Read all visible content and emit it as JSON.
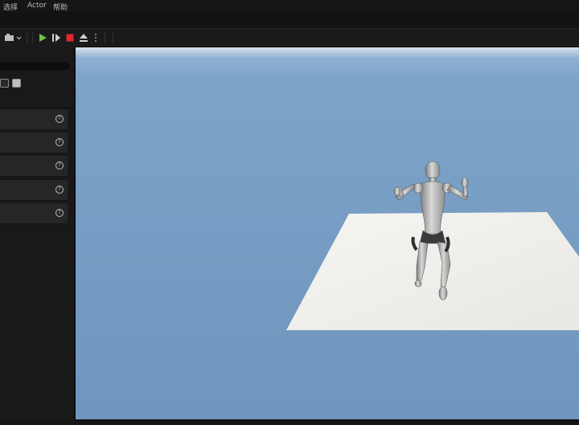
{
  "menubar": {
    "items": [
      {
        "label": "选择"
      },
      {
        "label": "Actor"
      },
      {
        "label": "帮助"
      }
    ]
  },
  "toolbar": {
    "icons": {
      "mode": "camera-icon",
      "play": "play-icon",
      "advance": "play-advance-icon",
      "stop": "stop-icon",
      "eject": "eject-icon",
      "more": "more-icon"
    },
    "colors": {
      "play": "#6cc34a",
      "stop": "#e0262b"
    }
  },
  "viewport": {
    "sky_color": "#7da3c8",
    "floor_color": "#f2f1ee",
    "character": "mannequin"
  },
  "details_panel": {
    "row_count": 5
  }
}
